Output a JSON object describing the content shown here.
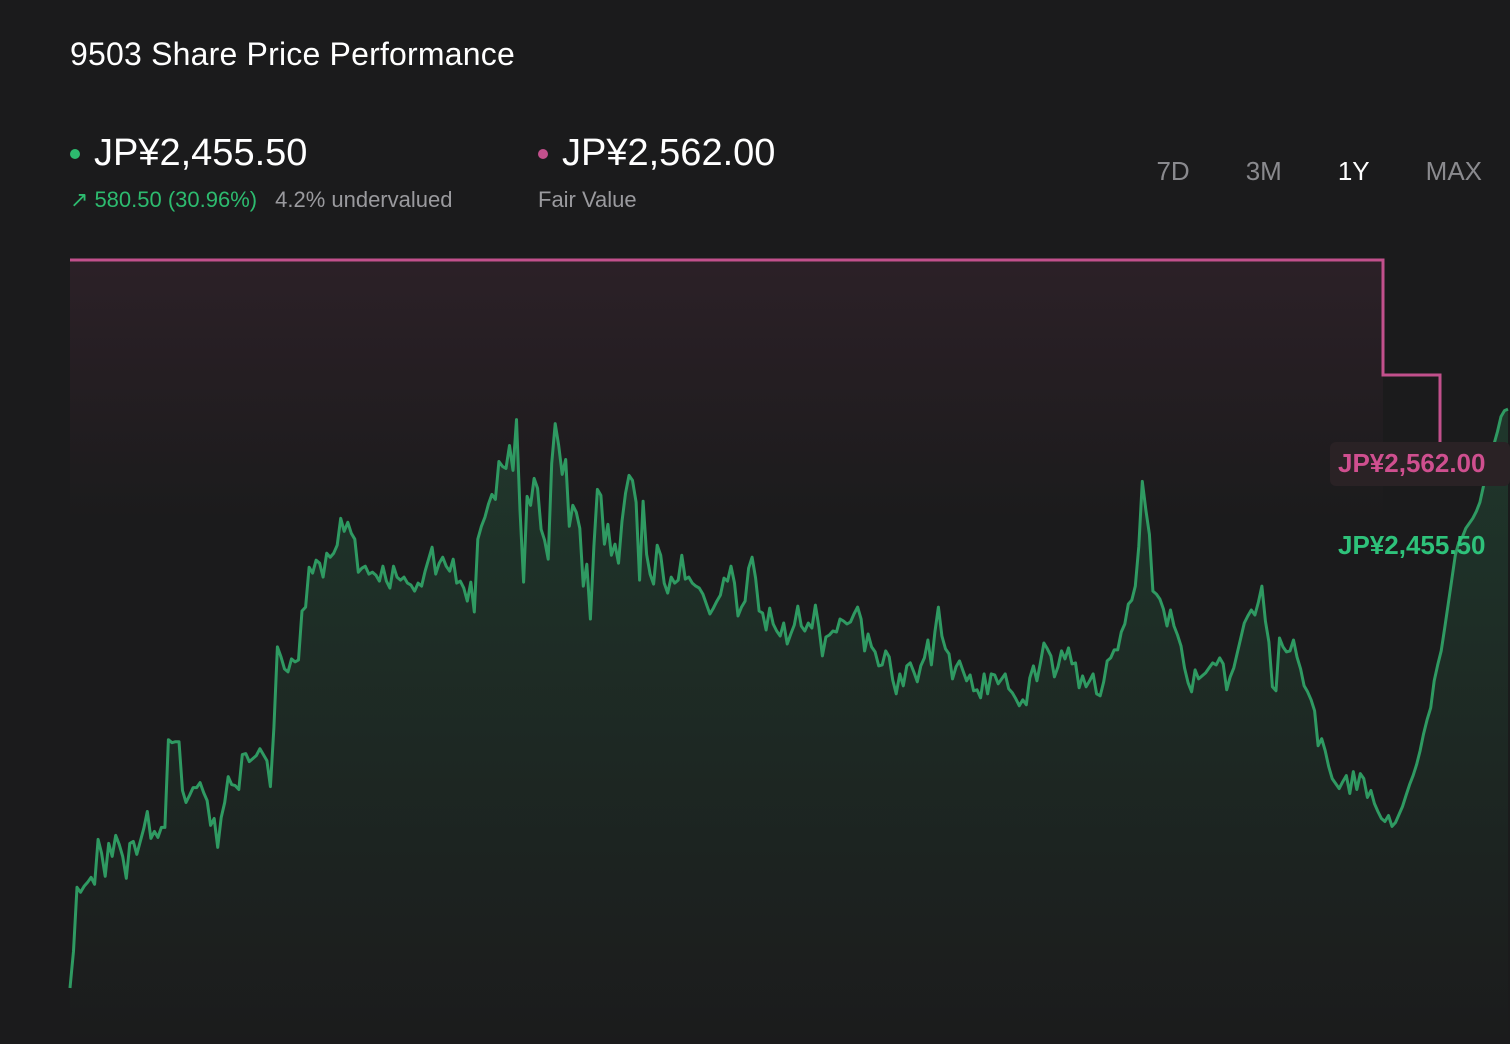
{
  "header": {
    "title": "9503 Share Price Performance"
  },
  "current": {
    "price": "JP¥2,455.50",
    "change": "580.50 (30.96%)",
    "valuation": "4.2% undervalued"
  },
  "fair_value": {
    "price": "JP¥2,562.00",
    "label": "Fair Value"
  },
  "tabs": [
    {
      "label": "7D",
      "active": false
    },
    {
      "label": "3M",
      "active": false
    },
    {
      "label": "1Y",
      "active": true
    },
    {
      "label": "MAX",
      "active": false
    }
  ],
  "colors": {
    "price_line": "#2f9a62",
    "fair_value_line": "#c2508c",
    "positive": "#2dbb6f",
    "fair_value_text": "#cf4f8f",
    "price_tag_text": "#2ec27a"
  },
  "chart_data": {
    "type": "line",
    "ylim": [
      1870,
      2612
    ],
    "series": [
      {
        "values": [
          1875,
          1912,
          1976,
          1971,
          1977,
          1981,
          1986,
          1979,
          2024,
          2010,
          1987,
          2020,
          2007,
          2028,
          2019,
          2007,
          1985,
          2020,
          2022,
          2009,
          2022,
          2035,
          2052,
          2025,
          2032,
          2026,
          2036,
          2036,
          2124,
          2121,
          2122,
          2122,
          2073,
          2061,
          2068,
          2076,
          2076,
          2081,
          2071,
          2063,
          2038,
          2045,
          2016,
          2046,
          2061,
          2087,
          2079,
          2078,
          2074,
          2109,
          2110,
          2102,
          2105,
          2108,
          2115,
          2109,
          2103,
          2077,
          2136,
          2217,
          2207,
          2195,
          2192,
          2205,
          2202,
          2204,
          2253,
          2257,
          2297,
          2291,
          2304,
          2301,
          2287,
          2311,
          2307,
          2311,
          2319,
          2346,
          2333,
          2342,
          2331,
          2325,
          2292,
          2296,
          2298,
          2290,
          2292,
          2289,
          2283,
          2298,
          2283,
          2276,
          2298,
          2287,
          2284,
          2287,
          2281,
          2279,
          2273,
          2281,
          2278,
          2293,
          2305,
          2317,
          2290,
          2301,
          2307,
          2298,
          2293,
          2305,
          2281,
          2283,
          2276,
          2263,
          2282,
          2252,
          2325,
          2338,
          2347,
          2360,
          2370,
          2365,
          2403,
          2398,
          2396,
          2419,
          2394,
          2445,
          2354,
          2282,
          2368,
          2359,
          2386,
          2376,
          2335,
          2324,
          2305,
          2401,
          2441,
          2419,
          2390,
          2405,
          2338,
          2359,
          2352,
          2336,
          2278,
          2300,
          2245,
          2318,
          2375,
          2369,
          2320,
          2340,
          2309,
          2320,
          2301,
          2343,
          2371,
          2389,
          2384,
          2362,
          2284,
          2363,
          2310,
          2290,
          2280,
          2319,
          2309,
          2281,
          2271,
          2287,
          2281,
          2284,
          2309,
          2285,
          2287,
          2281,
          2278,
          2276,
          2270,
          2260,
          2250,
          2256,
          2263,
          2269,
          2286,
          2283,
          2298,
          2281,
          2248,
          2257,
          2263,
          2296,
          2307,
          2286,
          2253,
          2251,
          2234,
          2256,
          2240,
          2233,
          2228,
          2241,
          2220,
          2230,
          2239,
          2258,
          2238,
          2233,
          2241,
          2236,
          2259,
          2237,
          2208,
          2227,
          2229,
          2233,
          2232,
          2245,
          2243,
          2240,
          2242,
          2250,
          2257,
          2245,
          2213,
          2230,
          2217,
          2212,
          2198,
          2199,
          2213,
          2207,
          2184,
          2170,
          2190,
          2178,
          2198,
          2201,
          2192,
          2182,
          2198,
          2206,
          2224,
          2199,
          2232,
          2257,
          2228,
          2215,
          2210,
          2185,
          2197,
          2203,
          2193,
          2183,
          2189,
          2173,
          2174,
          2166,
          2190,
          2170,
          2190,
          2189,
          2180,
          2185,
          2190,
          2175,
          2171,
          2165,
          2158,
          2164,
          2159,
          2186,
          2198,
          2183,
          2201,
          2221,
          2215,
          2208,
          2187,
          2197,
          2213,
          2205,
          2216,
          2200,
          2201,
          2176,
          2188,
          2177,
          2183,
          2190,
          2170,
          2168,
          2182,
          2203,
          2206,
          2214,
          2214,
          2232,
          2240,
          2260,
          2264,
          2278,
          2318,
          2383,
          2354,
          2330,
          2273,
          2270,
          2265,
          2255,
          2238,
          2254,
          2238,
          2229,
          2218,
          2196,
          2181,
          2172,
          2194,
          2185,
          2188,
          2191,
          2196,
          2201,
          2199,
          2206,
          2200,
          2174,
          2187,
          2196,
          2211,
          2226,
          2241,
          2248,
          2254,
          2249,
          2262,
          2278,
          2243,
          2222,
          2177,
          2173,
          2226,
          2217,
          2212,
          2213,
          2224,
          2207,
          2195,
          2178,
          2172,
          2164,
          2153,
          2118,
          2125,
          2113,
          2097,
          2085,
          2080,
          2075,
          2082,
          2088,
          2070,
          2092,
          2074,
          2090,
          2085,
          2066,
          2073,
          2060,
          2052,
          2045,
          2042,
          2048,
          2037,
          2041,
          2049,
          2057,
          2068,
          2079,
          2088,
          2099,
          2113,
          2130,
          2144,
          2156,
          2183,
          2199,
          2213,
          2236,
          2260,
          2284,
          2309,
          2322,
          2327,
          2336,
          2341,
          2346,
          2353,
          2362,
          2378,
          2396,
          2405,
          2420,
          2433,
          2448,
          2454,
          2455.5
        ]
      }
    ]
  }
}
